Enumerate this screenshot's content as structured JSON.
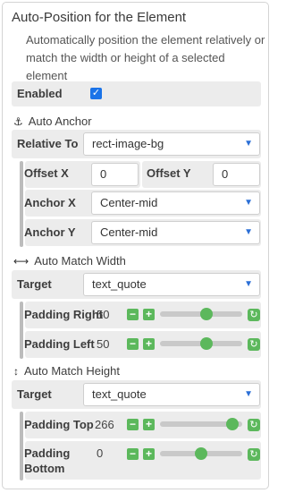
{
  "panel": {
    "title": "Auto-Position for the Element",
    "description": "Automatically position the element relatively or match the width or height of a selected element",
    "enabled_label": "Enabled",
    "enabled": true
  },
  "auto_anchor": {
    "header": "Auto Anchor",
    "icon": "anchor-icon",
    "relative_to_label": "Relative To",
    "relative_to_value": "rect-image-bg",
    "offset_x_label": "Offset X",
    "offset_x_value": "0",
    "offset_y_label": "Offset Y",
    "offset_y_value": "0",
    "anchor_x_label": "Anchor X",
    "anchor_x_value": "Center-mid",
    "anchor_y_label": "Anchor Y",
    "anchor_y_value": "Center-mid"
  },
  "auto_match_width": {
    "header": "Auto Match Width",
    "icon": "horizontal-arrows-icon",
    "target_label": "Target",
    "target_value": "text_quote",
    "padding_right_label": "Padding Right",
    "padding_right_value": "50",
    "padding_right_level": 0.57,
    "padding_left_label": "Padding Left",
    "padding_left_value": "50",
    "padding_left_level": 0.57
  },
  "auto_match_height": {
    "header": "Auto Match Height",
    "icon": "vertical-arrows-icon",
    "target_label": "Target",
    "target_value": "text_quote",
    "padding_top_label": "Padding Top",
    "padding_top_value": "266",
    "padding_top_level": 0.88,
    "padding_bottom_label": "Padding Bottom",
    "padding_bottom_value": "0",
    "padding_bottom_level": 0.5
  },
  "colors": {
    "accent_green": "#5cb85c",
    "accent_blue": "#1a73e8",
    "row_gray": "#ececec"
  }
}
